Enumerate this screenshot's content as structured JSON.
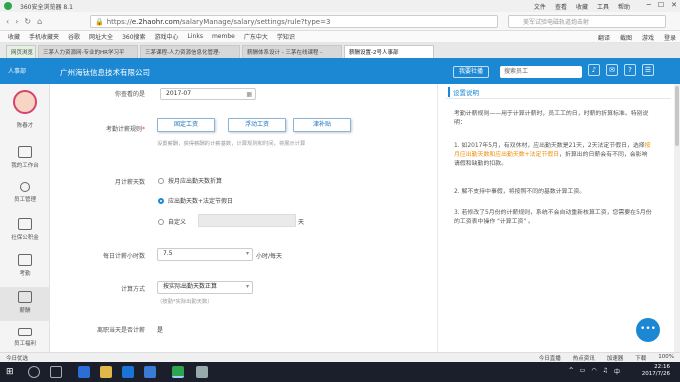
{
  "browser": {
    "title": "360安全浏览器 8.1",
    "menus": [
      "文件",
      "查看",
      "收藏",
      "工具",
      "帮助"
    ],
    "url_host": "e.2haohr.com",
    "url_path": "/salaryManage/salary/settings/rule?type=3",
    "url_scheme": "https://",
    "search_placeholder": "美军试验电磁轨道炮击射",
    "bookmarks": [
      "收藏",
      "手机收藏夹",
      "谷歌",
      "网址大全",
      "360搜索",
      "游戏中心",
      "Links",
      "membe",
      "广东中大",
      "学知识"
    ],
    "bookmarks_right": [
      "翻译",
      "截图",
      "游戏",
      "登录"
    ],
    "tabs": [
      "网页浏览",
      "三茅人力资源网-专业的HR学习平",
      "三茅课程-人力资源信息化管理-",
      "薪酬体系设计 - 三茅在线课程 -",
      "薪酬设置-2号人事部"
    ],
    "status_left": "今日优选",
    "status_right": [
      "今日直播",
      "热点资讯",
      "加速器",
      "下载",
      "100%"
    ]
  },
  "app": {
    "logo_text": "人事部",
    "company": "广州海钛信息技术有限公司",
    "settings_btn": "我要社播",
    "search_value": "搜索员工",
    "user_name": "陈春才",
    "nav": [
      "我的工作台",
      "员工管理",
      "社保公积金",
      "考勤",
      "薪酬",
      "员工福利"
    ]
  },
  "form": {
    "effective_label": "你查看的是",
    "effective_value": "2017-07",
    "calc_rule_label": "考勤计薪规则",
    "rule_options": [
      "固定工资",
      "浮动工资",
      "津补贴"
    ],
    "rule_hint": "设置薪酬，获得薪酬的计薪基数，计算规则和时间，将展示计算",
    "monthly_days_label": "月计薪天数",
    "radio_1": "按月应出勤天数折算",
    "radio_2": "应出勤天数+法定节假日",
    "radio_3": "自定义",
    "custom_unit": "天",
    "daily_hours_label": "每日计薪小时数",
    "daily_hours_value": "7.5",
    "daily_hours_unit": "小时/每天",
    "calc_mode_label": "计算方式",
    "calc_mode_value": "按实际出勤天数正算",
    "calc_mode_hint": "（按勤*实际出勤天数）",
    "leave_label": "离职当天是否计薪",
    "leave_value": "是"
  },
  "panel": {
    "title": "设置说明",
    "intro": "考勤计薪规则——用于计算计薪时，员工工的日，时薪的折算标准。特别说明：",
    "p1_a": "1. 如2017年5月，有双休材，应出勤天数是21天，2天法定节假日，选择",
    "p1_hl": "按月应出勤天数和应出勤天数+法定节假日",
    "p1_b": "，折算出的日薪会有不同，会影响请假和缺勤的扣款。",
    "p2": "2. 解不支持中事假，将按照不同的基数计算工资。",
    "p3": "3. 若修改了5月份的计薪规则，系统不会自动重新核算工资，您需要在5月份的工资表中操作 \"计算工资\" 。"
  },
  "taskbar": {
    "time": "22:16",
    "date": "2017/7/26",
    "lang": "中"
  }
}
